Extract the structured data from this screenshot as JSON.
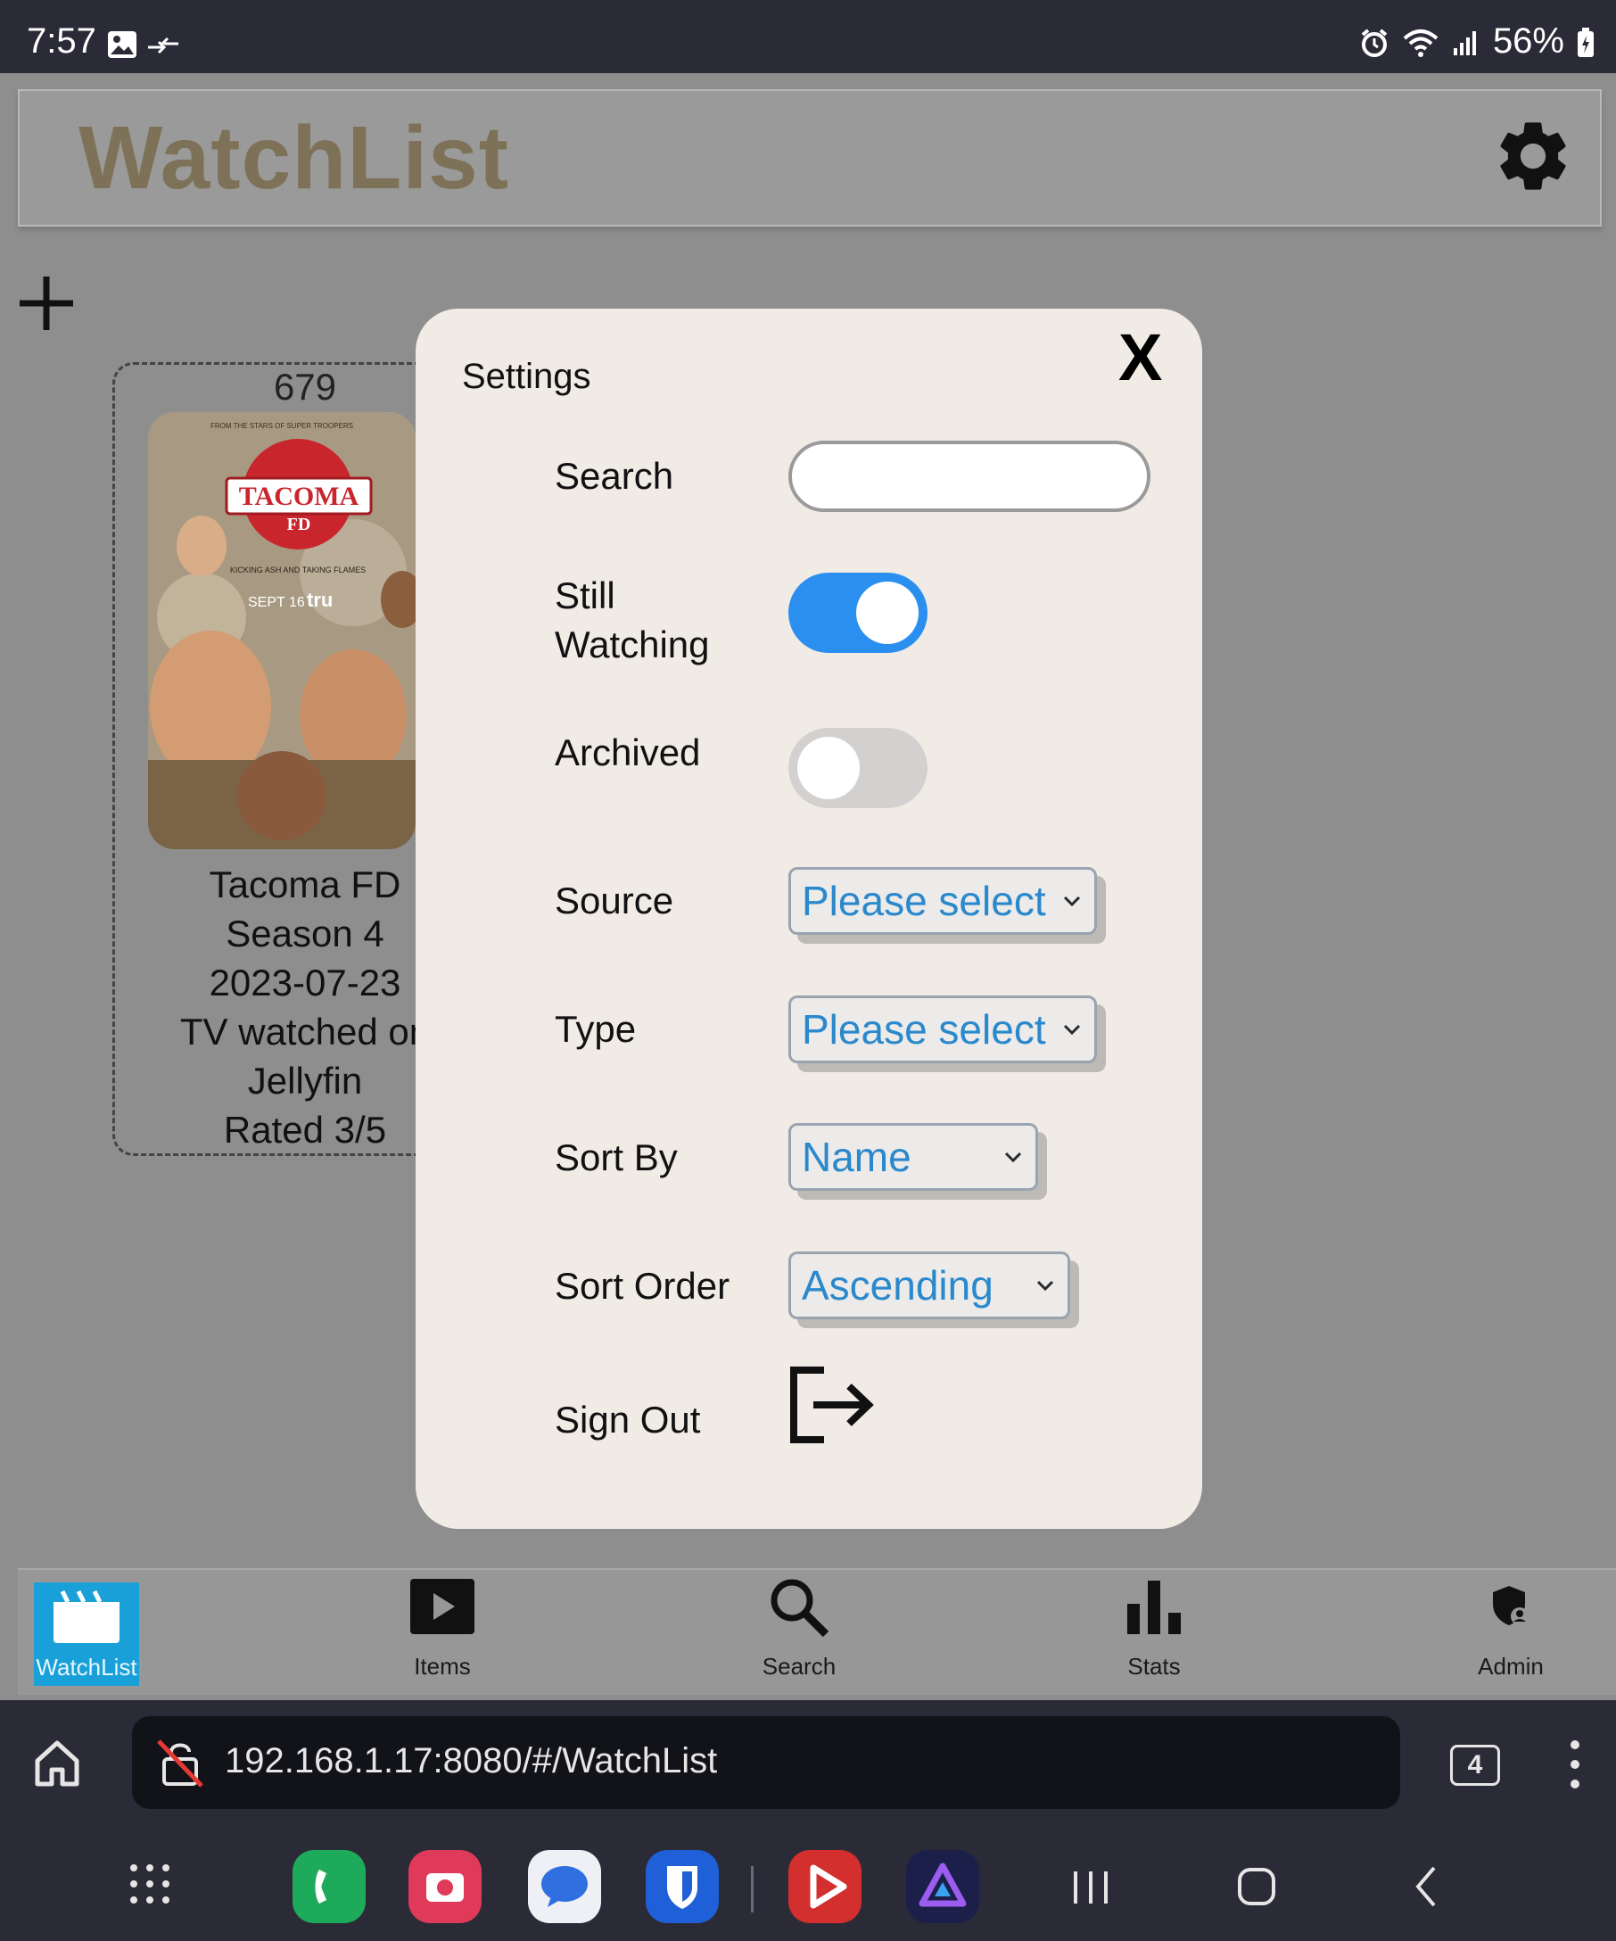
{
  "status_bar": {
    "time": "7:57",
    "battery": "56%"
  },
  "app": {
    "title": "WatchList"
  },
  "card": {
    "count": "679",
    "title": "Tacoma FD",
    "season": "Season 4",
    "date": "2023-07-23",
    "watched": "TV watched on",
    "source": "Jellyfin",
    "rating": "Rated 3/5",
    "poster_text": {
      "tagline": "FROM THE STARS OF SUPER TROOPERS",
      "logo": "TACOMA",
      "logo_sub": "FD",
      "kicking": "KICKING ASH AND TAKING FLAMES",
      "date": "SEPT 16",
      "network": "tru"
    }
  },
  "settings": {
    "title": "Settings",
    "close_label": "X",
    "search_label": "Search",
    "search_value": "",
    "still_watching_label_1": "Still",
    "still_watching_label_2": "Watching",
    "still_watching_on": true,
    "archived_label": "Archived",
    "archived_on": false,
    "source_label": "Source",
    "source_value": "Please select",
    "type_label": "Type",
    "type_value": "Please select",
    "sort_by_label": "Sort By",
    "sort_by_value": "Name",
    "sort_order_label": "Sort Order",
    "sort_order_value": "Ascending",
    "sign_out_label": "Sign Out"
  },
  "nav": {
    "watchlist": "WatchList",
    "items": "Items",
    "search": "Search",
    "stats": "Stats",
    "admin": "Admin"
  },
  "browser": {
    "url": "192.168.1.17:8080/#/WatchList",
    "tab_count": "4"
  },
  "colors": {
    "accent": "#2b8ff0",
    "brand": "#7d7258",
    "active_nav": "#1aa0d8",
    "select_text": "#2a88cc"
  }
}
